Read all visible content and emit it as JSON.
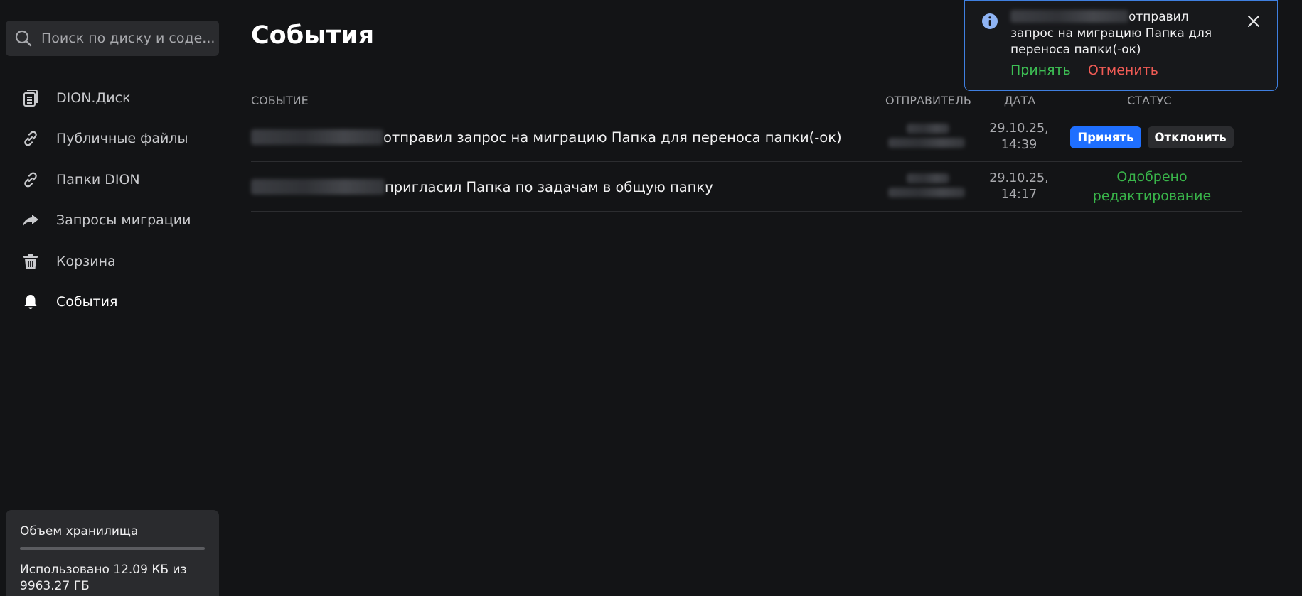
{
  "search": {
    "placeholder": "Поиск по диску и соде..."
  },
  "sidebar": {
    "items": [
      {
        "label": "DION.Диск",
        "icon": "disk-icon"
      },
      {
        "label": "Публичные файлы",
        "icon": "link-icon"
      },
      {
        "label": "Папки DION",
        "icon": "link-icon"
      },
      {
        "label": "Запросы миграции",
        "icon": "share-arrow-icon"
      },
      {
        "label": "Корзина",
        "icon": "trash-icon"
      },
      {
        "label": "События",
        "icon": "bell-icon",
        "active": true
      }
    ],
    "storage": {
      "title": "Объем хранилища",
      "used_line1": "Использовано 12.09 КБ из",
      "used_line2": "9963.27 ГБ",
      "used_fraction": 0.0
    }
  },
  "page": {
    "title": "События"
  },
  "table": {
    "headers": {
      "event": "СОБЫТИЕ",
      "sender": "ОТПРАВИТЕЛЬ",
      "date": "ДАТА",
      "status": "СТАТУС"
    },
    "rows": [
      {
        "event": "отправил запрос на миграцию Папка для переноса папки(-ок)",
        "date_line1": "29.10.25,",
        "date_line2": "14:39",
        "accept_label": "Принять",
        "decline_label": "Отклонить"
      },
      {
        "event": "пригласил Папка по задачам в общую папку",
        "date_line1": "29.10.25,",
        "date_line2": "14:17",
        "status_line1": "Одобрено",
        "status_line2": "редактирование"
      }
    ]
  },
  "toast": {
    "message_line1": "отправил",
    "message_line2": "запрос на миграцию Папка для",
    "message_line3": "переноса папки(-ок)",
    "accept_label": "Принять",
    "cancel_label": "Отменить"
  },
  "colors": {
    "accent": "#1f6fff",
    "success": "#39b54a",
    "danger": "#f05b55",
    "background": "#131416"
  }
}
